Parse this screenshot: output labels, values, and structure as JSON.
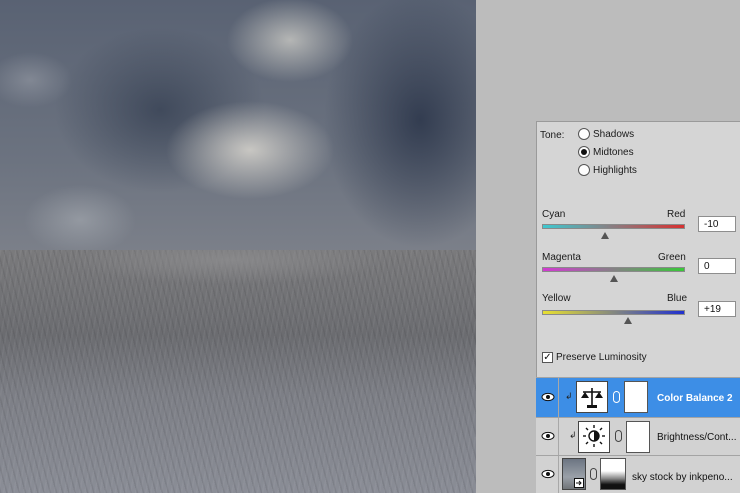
{
  "tone": {
    "label": "Tone:",
    "options": [
      {
        "label": "Shadows",
        "selected": false
      },
      {
        "label": "Midtones",
        "selected": true
      },
      {
        "label": "Highlights",
        "selected": false
      }
    ]
  },
  "sliders": [
    {
      "left": "Cyan",
      "right": "Red",
      "value": "-10",
      "position": 0.44,
      "from": "#3ec8d0",
      "to": "#d83030"
    },
    {
      "left": "Magenta",
      "right": "Green",
      "value": "0",
      "position": 0.5,
      "from": "#d23ad2",
      "to": "#38c838"
    },
    {
      "left": "Yellow",
      "right": "Blue",
      "value": "+19",
      "position": 0.6,
      "from": "#e8e030",
      "to": "#2030d0"
    }
  ],
  "preserve_luminosity": {
    "label": "Preserve Luminosity",
    "checked": true
  },
  "layers": [
    {
      "name": "Color Balance 2",
      "icon": "color-balance-icon",
      "selected": true
    },
    {
      "name": "Brightness/Cont...",
      "icon": "brightness-contrast-icon",
      "selected": false
    },
    {
      "name": "sky stock by inkpeno...",
      "icon": "smart-object-icon",
      "selected": false
    }
  ],
  "colors": {
    "selection": "#3d8ee6",
    "panel": "#d5d5d5",
    "workspace": "#bcbcbc"
  }
}
